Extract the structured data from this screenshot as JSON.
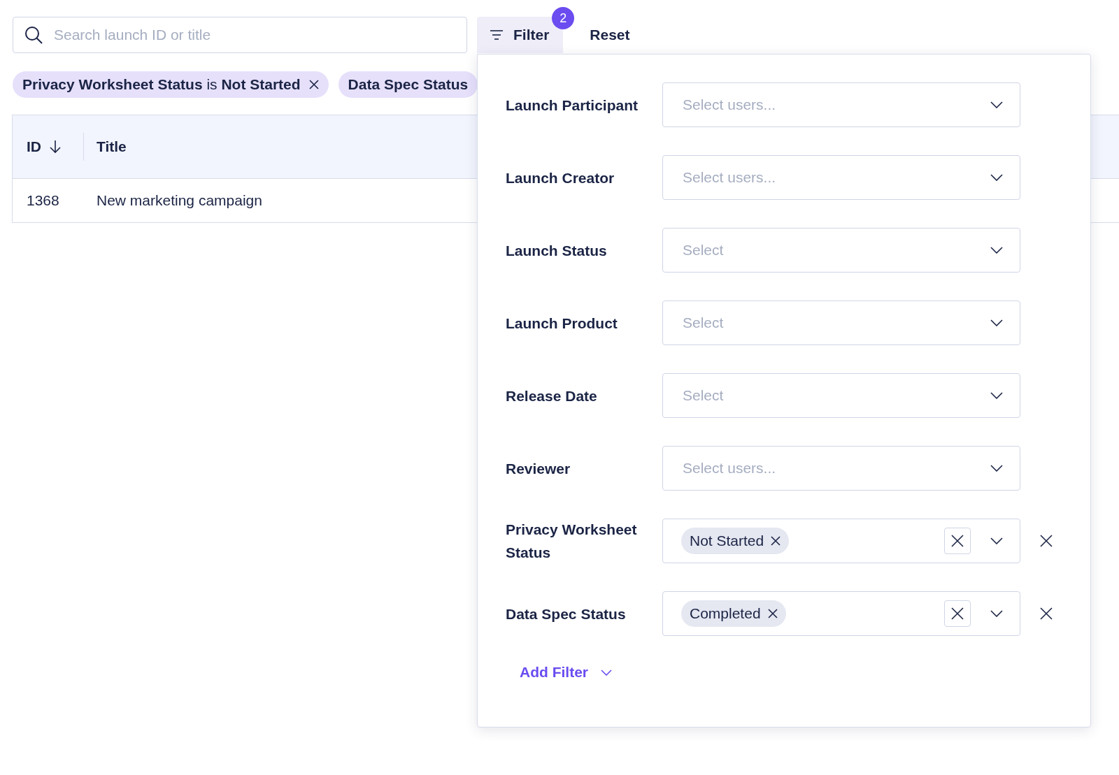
{
  "search": {
    "placeholder": "Search launch ID or title"
  },
  "filter_button": {
    "label": "Filter",
    "badge": "2"
  },
  "reset_button": {
    "label": "Reset"
  },
  "active_filters": [
    {
      "text": "**Privacy Worksheet Status** is **Not Started**",
      "removable": true
    },
    {
      "text": "**Data Spec Status**",
      "removable": false
    }
  ],
  "table": {
    "columns": [
      {
        "label": "ID",
        "sorted": true
      },
      {
        "label": "Title",
        "sorted": false
      }
    ],
    "rows": [
      {
        "id": "1368",
        "title": "New marketing campaign"
      }
    ]
  },
  "filter_panel": {
    "filters": [
      {
        "label": "Launch Participant",
        "kind": "select",
        "placeholder": "Select users..."
      },
      {
        "label": "Launch Creator",
        "kind": "select",
        "placeholder": "Select users..."
      },
      {
        "label": "Launch Status",
        "kind": "select",
        "placeholder": "Select"
      },
      {
        "label": "Launch Product",
        "kind": "select",
        "placeholder": "Select"
      },
      {
        "label": "Release Date",
        "kind": "select",
        "placeholder": "Select"
      },
      {
        "label": "Reviewer",
        "kind": "select",
        "placeholder": "Select users..."
      },
      {
        "label": "Privacy Worksheet Status",
        "kind": "tags",
        "tags": [
          "Not Started"
        ]
      },
      {
        "label": "Data Spec Status",
        "kind": "tags",
        "tags": [
          "Completed"
        ]
      }
    ],
    "add_filter": "Add Filter"
  }
}
